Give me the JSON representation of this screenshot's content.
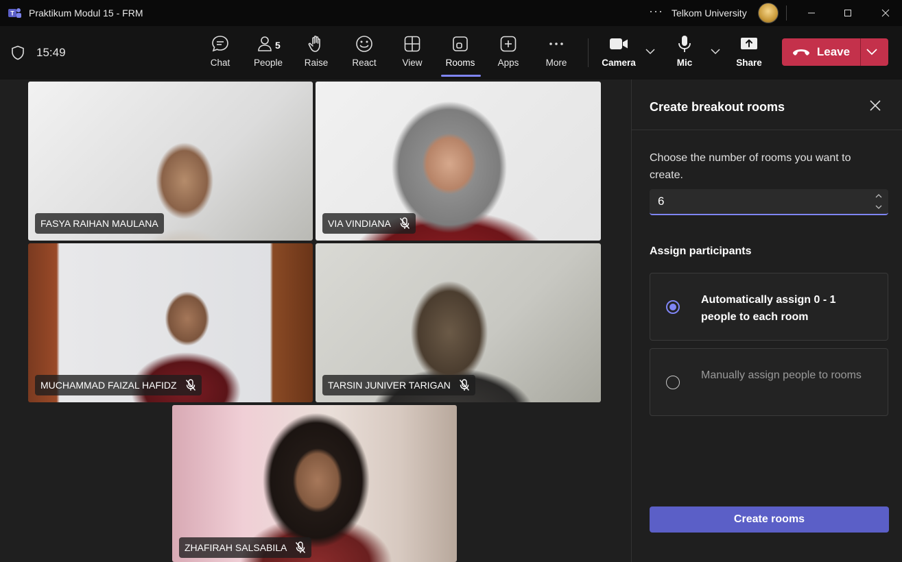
{
  "window": {
    "title": "Praktikum Modul 15 - FRM",
    "organization": "Telkom University",
    "more_glyph": "···"
  },
  "toolbar": {
    "time": "15:49",
    "people_count": "5",
    "items": [
      {
        "label": "Chat",
        "icon": "chat-icon"
      },
      {
        "label": "People",
        "icon": "people-icon"
      },
      {
        "label": "Raise",
        "icon": "hand-icon"
      },
      {
        "label": "React",
        "icon": "smile-icon"
      },
      {
        "label": "View",
        "icon": "grid-icon"
      },
      {
        "label": "Rooms",
        "icon": "rooms-icon",
        "active": true
      },
      {
        "label": "Apps",
        "icon": "plus-square-icon"
      },
      {
        "label": "More",
        "icon": "more-icon"
      }
    ],
    "camera_label": "Camera",
    "mic_label": "Mic",
    "share_label": "Share",
    "leave_label": "Leave"
  },
  "participants": [
    {
      "name": "FASYA RAIHAN MAULANA",
      "muted": false
    },
    {
      "name": "VIA VINDIANA",
      "muted": true
    },
    {
      "name": "MUCHAMMAD FAIZAL HAFIDZ",
      "muted": true
    },
    {
      "name": "TARSIN JUNIVER TARIGAN",
      "muted": true
    },
    {
      "name": "ZHAFIRAH SALSABILA",
      "muted": true
    }
  ],
  "panel": {
    "title": "Create breakout rooms",
    "description": "Choose the number of rooms you want to create.",
    "rooms_value": "6",
    "assign_heading": "Assign participants",
    "option_auto": "Automatically assign 0 - 1 people to each room",
    "option_manual": "Manually assign people to rooms",
    "create_label": "Create rooms"
  },
  "colors": {
    "accent": "#7f85f5",
    "leave": "#c4314b",
    "primary_button": "#5b5fc7"
  }
}
